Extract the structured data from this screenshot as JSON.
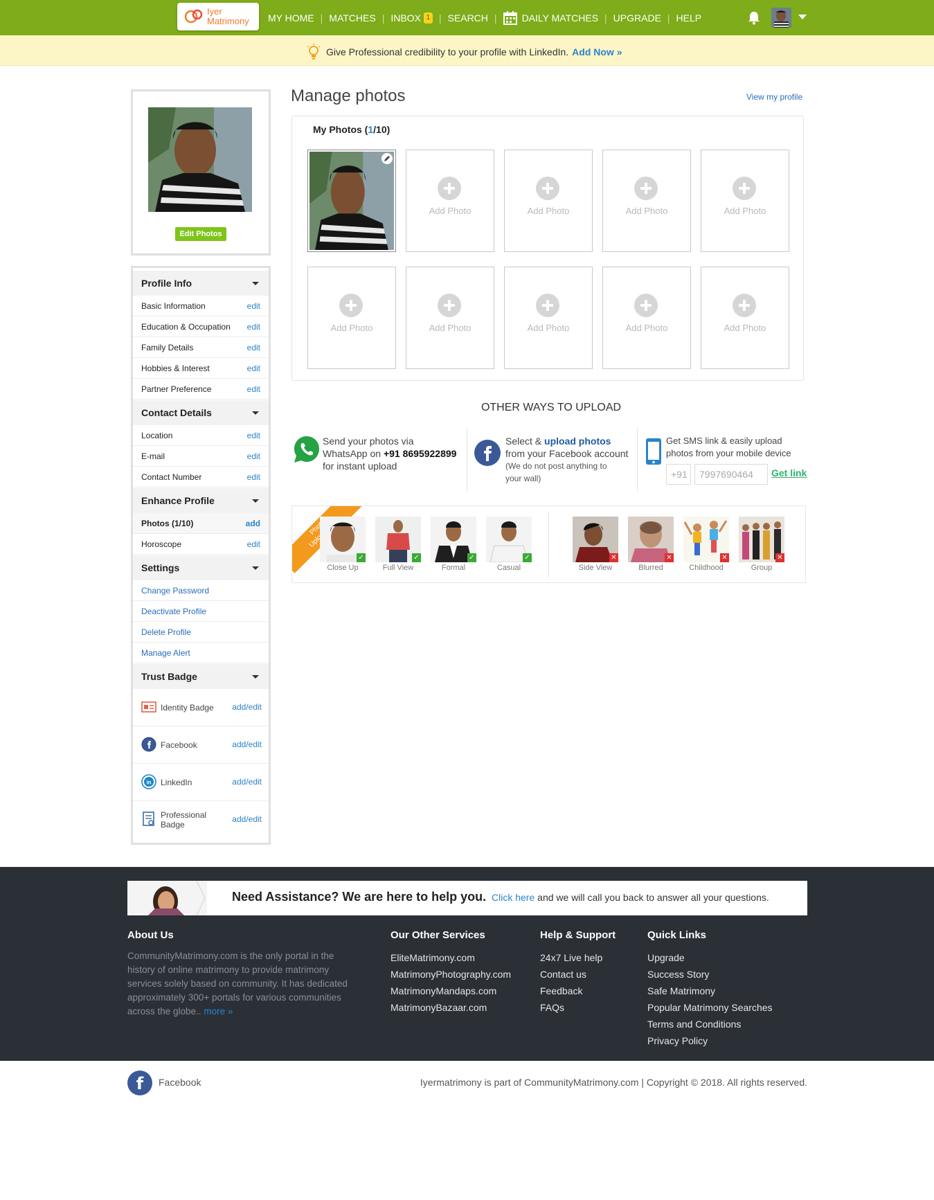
{
  "brand": {
    "logo_line1": "Iyer",
    "logo_line2": "Matrimony",
    "primary_color": "#7eac1a",
    "accent_color": "#2a84c9"
  },
  "nav": {
    "items": [
      "MY HOME",
      "MATCHES",
      "INBOX",
      "SEARCH",
      "DAILY MATCHES",
      "UPGRADE",
      "HELP"
    ],
    "inbox_badge": "1"
  },
  "notice": {
    "text": "Give Professional credibility to your profile with LinkedIn.",
    "cta": "Add Now »"
  },
  "profile_card": {
    "edit_photos": "Edit Photos"
  },
  "sidebar": {
    "profile_info": {
      "title": "Profile Info",
      "rows": [
        {
          "label": "Basic Information",
          "action": "edit"
        },
        {
          "label": "Education & Occupation",
          "action": "edit"
        },
        {
          "label": "Family Details",
          "action": "edit"
        },
        {
          "label": "Hobbies & Interest",
          "action": "edit"
        },
        {
          "label": "Partner Preference",
          "action": "edit"
        }
      ]
    },
    "contact_details": {
      "title": "Contact Details",
      "rows": [
        {
          "label": "Location",
          "action": "edit"
        },
        {
          "label": "E-mail",
          "action": "edit"
        },
        {
          "label": "Contact Number",
          "action": "edit"
        }
      ]
    },
    "enhance_profile": {
      "title": "Enhance Profile",
      "rows": [
        {
          "label": "Photos (1/10)",
          "action": "add"
        },
        {
          "label": "Horoscope",
          "action": "edit"
        }
      ]
    },
    "settings": {
      "title": "Settings",
      "links": [
        "Change Password",
        "Deactivate Profile",
        "Delete Profile",
        "Manage Alert"
      ]
    },
    "trust_badge": {
      "title": "Trust Badge",
      "rows": [
        {
          "label": "Identity Badge",
          "action": "add/edit",
          "icon": "id-card-icon"
        },
        {
          "label": "Facebook",
          "action": "add/edit",
          "icon": "facebook-icon"
        },
        {
          "label": "LinkedIn",
          "action": "add/edit",
          "icon": "linkedin-icon"
        },
        {
          "label": "Professional Badge",
          "action": "add/edit",
          "icon": "certificate-icon"
        }
      ]
    }
  },
  "main": {
    "title": "Manage photos",
    "view_profile": "View my profile",
    "my_photos_label": "My Photos",
    "photo_count_current": "1",
    "photo_count_total": "/10",
    "add_photo_label": "Add Photo",
    "other_ways_title": "OTHER WAYS TO UPLOAD",
    "whatsapp": {
      "line1": "Send your photos via",
      "line2": "WhatsApp on",
      "number": "+91 8695922899",
      "line3": "for instant upload"
    },
    "facebook": {
      "line1_pre": "Select &",
      "line1_link": "upload photos",
      "line2": "from your Facebook account",
      "note1": "(We do not post anything to",
      "note2": "your wall)"
    },
    "sms": {
      "line1": "Get SMS link & easily upload",
      "line2": "photos from your mobile device",
      "country_code": "+91",
      "phone": "7997690464",
      "cta": "Get link"
    },
    "tips": {
      "ribbon_line1": "Photo",
      "ribbon_line2": "Upload Tips",
      "good": [
        "Close Up",
        "Full View",
        "Formal",
        "Casual"
      ],
      "bad": [
        "Side View",
        "Blurred",
        "Childhood",
        "Group"
      ]
    }
  },
  "footer": {
    "assist_title": "Need Assistance? We are here to help you.",
    "assist_link": "Click here",
    "assist_rest": "and we will call you back to answer all your questions.",
    "about": {
      "title": "About Us",
      "text": "CommunityMatrimony.com is the only portal in the history of online matrimony to provide matrimony services solely based on community. It has dedicated approximately 300+ portals for various communities across the globe..",
      "more": "more »"
    },
    "services": {
      "title": "Our Other Services",
      "links": [
        "EliteMatrimony.com",
        "MatrimonyPhotography.com",
        "MatrimonyMandaps.com",
        "MatrimonyBazaar.com"
      ]
    },
    "help": {
      "title": "Help & Support",
      "links": [
        "24x7 Live help",
        "Contact us",
        "Feedback",
        "FAQs"
      ]
    },
    "quick": {
      "title": "Quick Links",
      "links": [
        "Upgrade",
        "Success Story",
        "Safe Matrimony",
        "Popular Matrimony Searches",
        "Terms and Conditions",
        "Privacy Policy"
      ]
    },
    "facebook_label": "Facebook",
    "copyright": "Iyermatrimony is part of CommunityMatrimony.com | Copyright © 2018. All rights reserved."
  }
}
